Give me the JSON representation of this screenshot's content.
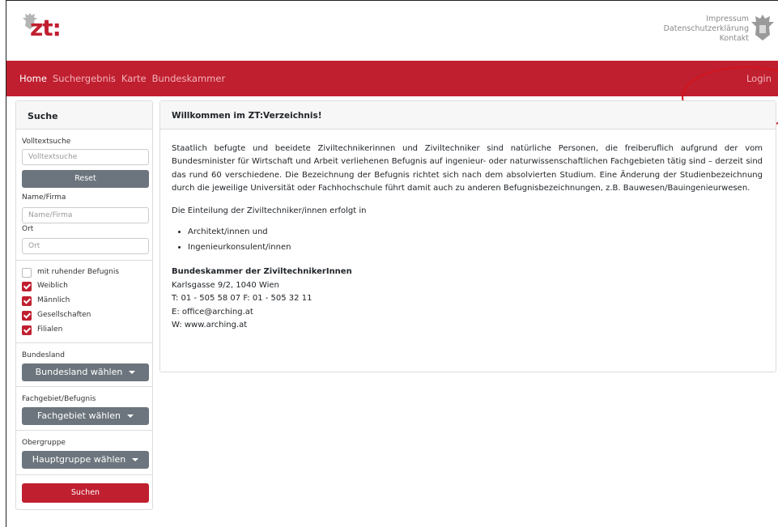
{
  "header": {
    "logo_text": "zt:",
    "links": [
      "Impressum",
      "Datenschutzerklärung",
      "Kontakt"
    ]
  },
  "nav": {
    "items": [
      "Home",
      "Suchergebnis",
      "Karte",
      "Bundeskammer"
    ],
    "login": "Login"
  },
  "sidebar": {
    "title": "Suche",
    "fulltext_label": "Volltextsuche",
    "fulltext_placeholder": "Volltextsuche",
    "reset": "Reset",
    "name_label": "Name/Firma",
    "name_placeholder": "Name/Firma",
    "ort_label": "Ort",
    "ort_placeholder": "Ort",
    "checkboxes": [
      {
        "label": "mit ruhender Befugnis",
        "checked": false
      },
      {
        "label": "Weiblich",
        "checked": true
      },
      {
        "label": "Männlich",
        "checked": true
      },
      {
        "label": "Gesellschaften",
        "checked": true
      },
      {
        "label": "Filialen",
        "checked": true
      }
    ],
    "bundesland_label": "Bundesland",
    "bundesland_btn": "Bundesland wählen",
    "fachgebiet_label": "Fachgebiet/Befugnis",
    "fachgebiet_btn": "Fachgebiet wählen",
    "obergruppe_label": "Obergruppe",
    "obergruppe_btn": "Hauptgruppe wählen",
    "search_btn": "Suchen"
  },
  "main": {
    "title": "Willkommen im ZT:Verzeichnis!",
    "intro": "Staatlich befugte und beeidete Ziviltechnikerinnen und Ziviltechniker sind natürliche Personen, die freiberuflich aufgrund der vom Bundesminister für Wirtschaft und Arbeit verliehenen Befugnis auf ingenieur- oder naturwissenschaftlichen Fachgebieten tätig sind – derzeit sind das rund 60 verschiedene. Die Bezeichnung der Befugnis richtet sich nach dem absolvierten Studium. Eine Änderung der Studienbezeichnung durch die jeweilige Universität oder Fachhochschule führt damit auch zu anderen Befugnisbezeichnungen, z.B. Bauwesen/Bauingenieurwesen.",
    "einteilung": "Die Einteilung der Ziviltechniker/innen erfolgt in",
    "list": [
      "Architekt/innen und",
      "Ingenieurkonsulent/innen"
    ],
    "contact": {
      "org": "Bundeskammer der ZiviltechnikerInnen",
      "address": "Karlsgasse 9/2, 1040 Wien",
      "phone": "T: 01 - 505 58 07 F: 01 - 505 32 11",
      "email": "E: office@arching.at",
      "web": "W: www.arching.at"
    }
  }
}
